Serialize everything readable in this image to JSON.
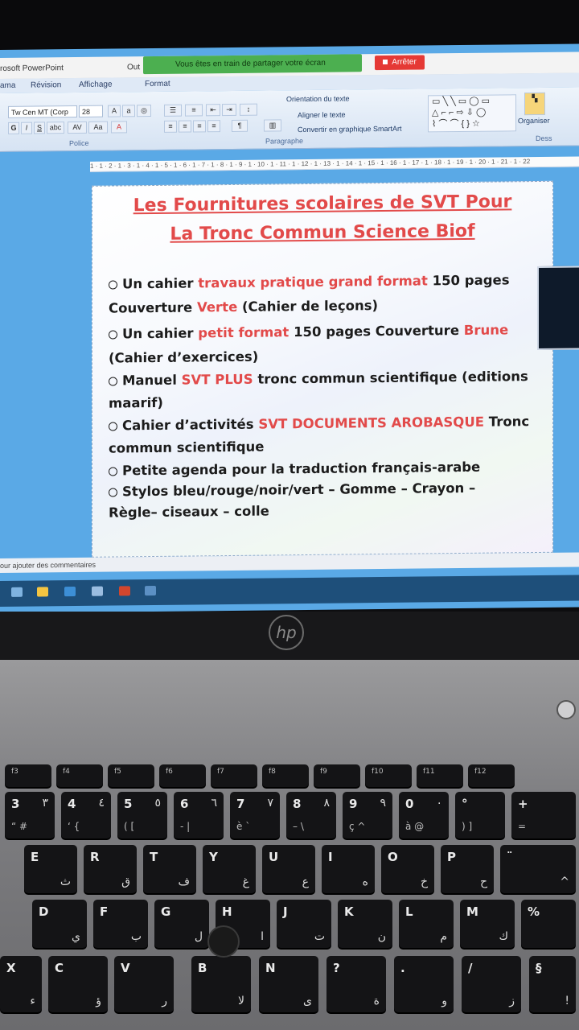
{
  "window": {
    "app_title": "rosoft PowerPoint",
    "tab_partial": "Out",
    "share_notice": "Vous êtes en train de partager votre écran",
    "stop_button": "Arrêter"
  },
  "ribbon": {
    "tabs": [
      "ama",
      "Révision",
      "Affichage",
      "Format"
    ],
    "font_name": "Tw Cen MT (Corp",
    "font_size": "28",
    "group_police": "Police",
    "group_paragraphe": "Paragraphe",
    "orientation_text": "Orientation du texte",
    "align_text": "Aligner le texte",
    "smartart_text": "Convertir en graphique SmartArt",
    "organiser": "Organiser",
    "dessin_partial": "Dess"
  },
  "ruler": {
    "text": "1 · 1 · 2 · 1 · 3 · 1 · 4 · 1 · 5 · 1 · 6 · 1 · 7 · 1 · 8 · 1 · 9 · 1 · 10 · 1 · 11 · 1 · 12 · 1 · 13 · 1 · 14 · 1 · 15 · 1 · 16 · 1 · 17 · 1 · 18 · 1 · 19 · 1 · 20 · 1 · 21 · 1 · 22"
  },
  "slide": {
    "title_line1": "Les Fournitures scolaires de SVT Pour",
    "title_line2": "La Tronc Commun Science Biof",
    "items": [
      {
        "a": "Un cahier ",
        "r": "travaux pratique grand format",
        "b": " 150 pages"
      },
      {
        "a": "Couverture ",
        "r": "Verte",
        "b": " (Cahier de leçons)"
      },
      {
        "a": "Un cahier ",
        "r": "petit format",
        "b": " 150 pages Couverture ",
        "r2": "Brune"
      },
      {
        "a": "(Cahier d’exercices)"
      },
      {
        "a": "Manuel ",
        "r": "SVT PLUS",
        "b": " tronc commun scientifique (editions"
      },
      {
        "a": "maarif)"
      },
      {
        "a": "Cahier d’activités ",
        "r": "SVT DOCUMENTS AROBASQUE",
        "b": " Tronc"
      },
      {
        "a": "commun scientifique"
      },
      {
        "a": "Petite agenda pour la traduction français-arabe"
      },
      {
        "a": "Stylos bleu/rouge/noir/vert – Gomme – Crayon –"
      },
      {
        "a": "Règle– ciseaux – colle"
      }
    ]
  },
  "status": {
    "comments_hint": "our ajouter des commentaires"
  },
  "laptop": {
    "brand": "hp"
  },
  "keyboard": {
    "fkeys": [
      "f3",
      "f4",
      "f5",
      "f6",
      "f7",
      "f8",
      "f9",
      "f10",
      "f11",
      "f12"
    ],
    "row_numbers": [
      {
        "l": "3",
        "a": "٣",
        "s": "“ #"
      },
      {
        "l": "4",
        "a": "٤",
        "s": "‘ {"
      },
      {
        "l": "5",
        "a": "٥",
        "s": "( ["
      },
      {
        "l": "6",
        "a": "٦",
        "s": "- |"
      },
      {
        "l": "7",
        "a": "٧",
        "s": "è `"
      },
      {
        "l": "8",
        "a": "٨",
        "s": "– \\"
      },
      {
        "l": "9",
        "a": "٩",
        "s": "ç ^"
      },
      {
        "l": "0",
        "a": "٠",
        "s": "à @"
      },
      {
        "l": "°",
        "a": "",
        "s": ") ]"
      },
      {
        "l": "+",
        "a": "",
        "s": "="
      }
    ],
    "row_top": [
      {
        "l": "E",
        "a": "ث"
      },
      {
        "l": "R",
        "a": "ق"
      },
      {
        "l": "T",
        "a": "ف"
      },
      {
        "l": "Y",
        "a": "غ"
      },
      {
        "l": "U",
        "a": "ع"
      },
      {
        "l": "I",
        "a": "ه"
      },
      {
        "l": "O",
        "a": "خ"
      },
      {
        "l": "P",
        "a": "ح"
      },
      {
        "l": "¨",
        "a": "^"
      }
    ],
    "row_home": [
      {
        "l": "D",
        "a": "ي"
      },
      {
        "l": "F",
        "a": "ب"
      },
      {
        "l": "G",
        "a": "ل"
      },
      {
        "l": "H",
        "a": "ا"
      },
      {
        "l": "J",
        "a": "ت"
      },
      {
        "l": "K",
        "a": "ن"
      },
      {
        "l": "L",
        "a": "م"
      },
      {
        "l": "M",
        "a": "ك"
      },
      {
        "l": "%",
        "a": ""
      }
    ],
    "row_bottom": [
      {
        "l": "X",
        "a": "ء"
      },
      {
        "l": "C",
        "a": "ؤ"
      },
      {
        "l": "V",
        "a": "ر"
      },
      {
        "l": "B",
        "a": "لا"
      },
      {
        "l": "N",
        "a": "ى"
      },
      {
        "l": "?",
        "a": "ة"
      },
      {
        "l": ".",
        "a": "و"
      },
      {
        "l": "/",
        "a": "ز"
      },
      {
        "l": "§",
        "a": "!"
      }
    ]
  },
  "colors": {
    "accent_red": "#e24a4a",
    "share_green": "#4caf50",
    "stop_red": "#e53935"
  }
}
